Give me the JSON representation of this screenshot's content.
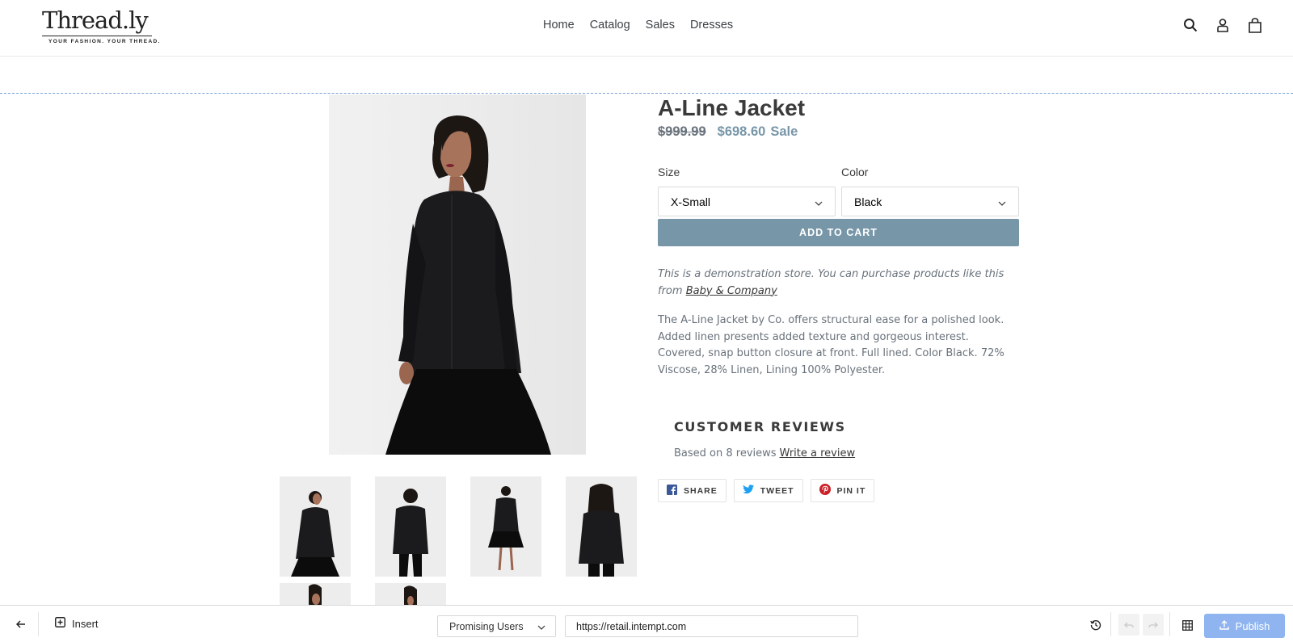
{
  "store": {
    "logo_text": "Thread.ly",
    "logo_tagline": "YOUR FASHION. YOUR THREAD.",
    "nav": [
      "Home",
      "Catalog",
      "Sales",
      "Dresses"
    ]
  },
  "product": {
    "title": "A-Line Jacket",
    "original_price": "$999.99",
    "sale_price": "$698.60",
    "sale_label": "Sale",
    "size_label": "Size",
    "size_value": "X-Small",
    "color_label": "Color",
    "color_value": "Black",
    "add_to_cart": "ADD TO CART",
    "notice_text": "This is a demonstration store. You can purchase products like this from",
    "notice_link": "Baby & Company",
    "description": "The A-Line Jacket by Co. offers structural ease for a polished look. Added linen presents added texture and gorgeous interest. Covered, snap button closure at front. Full lined. Color Black. 72% Viscose, 28% Linen, Lining 100% Polyester."
  },
  "reviews": {
    "title": "CUSTOMER REVIEWS",
    "summary": "Based on 8 reviews",
    "write_link": "Write a review"
  },
  "share": {
    "facebook": "SHARE",
    "twitter": "TWEET",
    "pinterest": "PIN IT"
  },
  "editor_bar": {
    "insert_label": "Insert",
    "segment": "Promising Users",
    "url": "https://retail.intempt.com",
    "publish_label": "Publish"
  },
  "colors": {
    "accent": "#7796a8",
    "publish": "#8fb4ef",
    "facebook": "#3b5998",
    "twitter": "#1da1f2",
    "pinterest": "#cb2027"
  }
}
